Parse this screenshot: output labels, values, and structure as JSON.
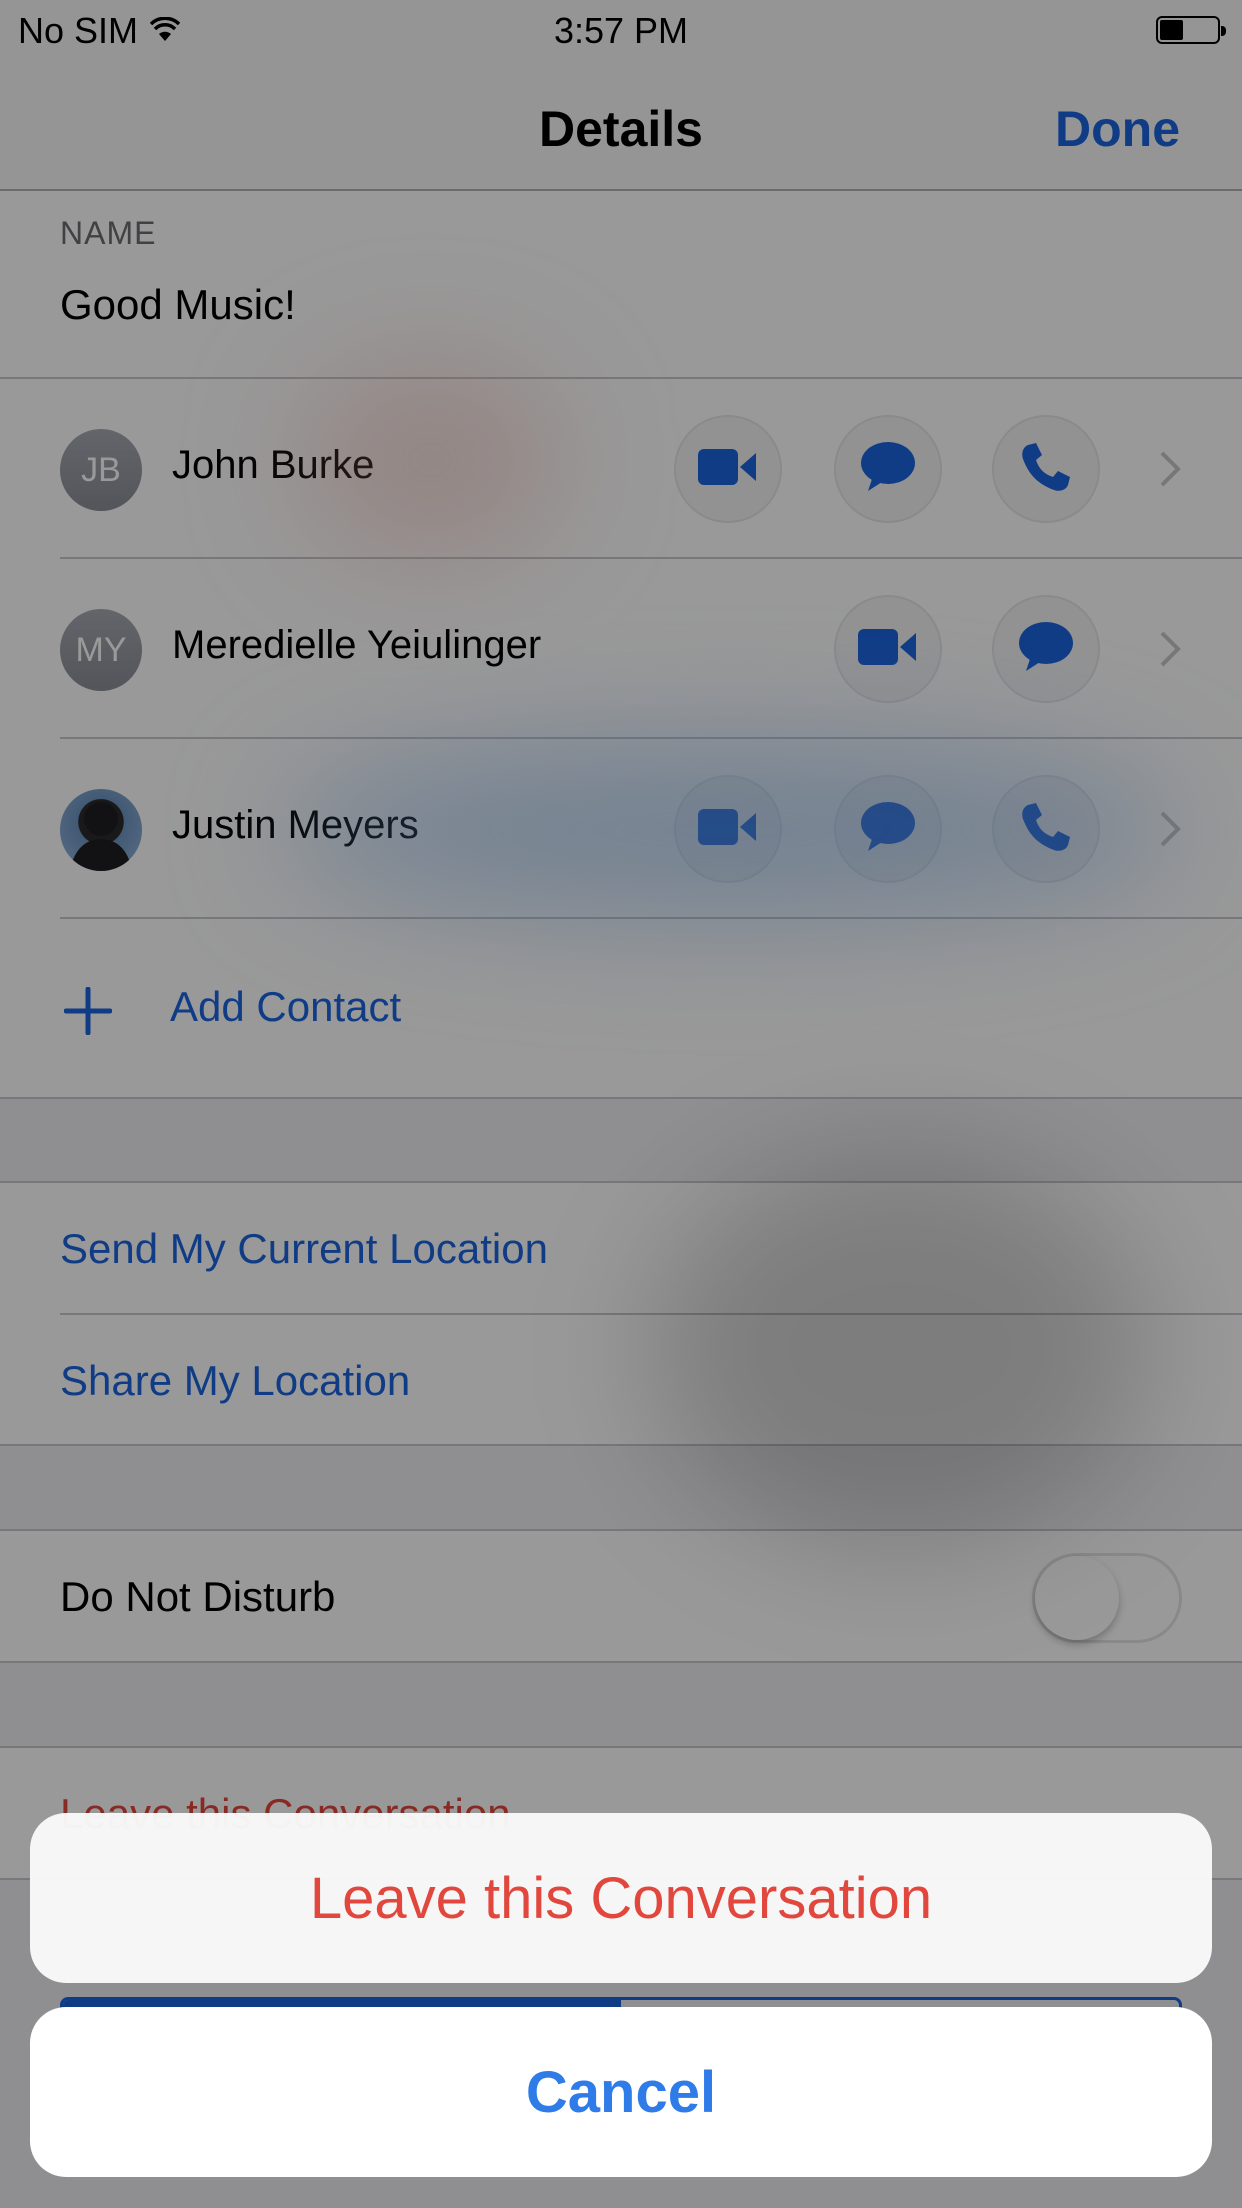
{
  "status_bar": {
    "carrier": "No SIM",
    "time": "3:57 PM",
    "battery_percent": 45,
    "wifi_icon": "wifi-icon",
    "battery_icon": "battery-icon"
  },
  "nav": {
    "title": "Details",
    "done_label": "Done"
  },
  "name_section": {
    "label": "NAME",
    "value": "Good Music!"
  },
  "contacts": [
    {
      "initials": "JB",
      "name": "John Burke",
      "has_photo": false,
      "actions": [
        "video-call-icon",
        "message-icon",
        "phone-icon"
      ]
    },
    {
      "initials": "MY",
      "name": "Meredielle Yeiulinger",
      "has_photo": false,
      "actions": [
        "video-call-icon",
        "message-icon"
      ]
    },
    {
      "initials": "",
      "name": "Justin Meyers",
      "has_photo": true,
      "actions": [
        "video-call-icon",
        "message-icon",
        "phone-icon"
      ]
    }
  ],
  "add_contact": {
    "label": "Add Contact",
    "icon": "plus-icon"
  },
  "location": {
    "send_current": "Send My Current Location",
    "share": "Share My Location"
  },
  "do_not_disturb": {
    "label": "Do Not Disturb",
    "enabled": false
  },
  "leave_row": {
    "label": "Leave this Conversation"
  },
  "action_sheet": {
    "destructive_label": "Leave this Conversation",
    "cancel_label": "Cancel"
  },
  "colors": {
    "accent": "#1c64e0",
    "destructive": "#e1473c",
    "cancel_text": "#2f7be8"
  }
}
